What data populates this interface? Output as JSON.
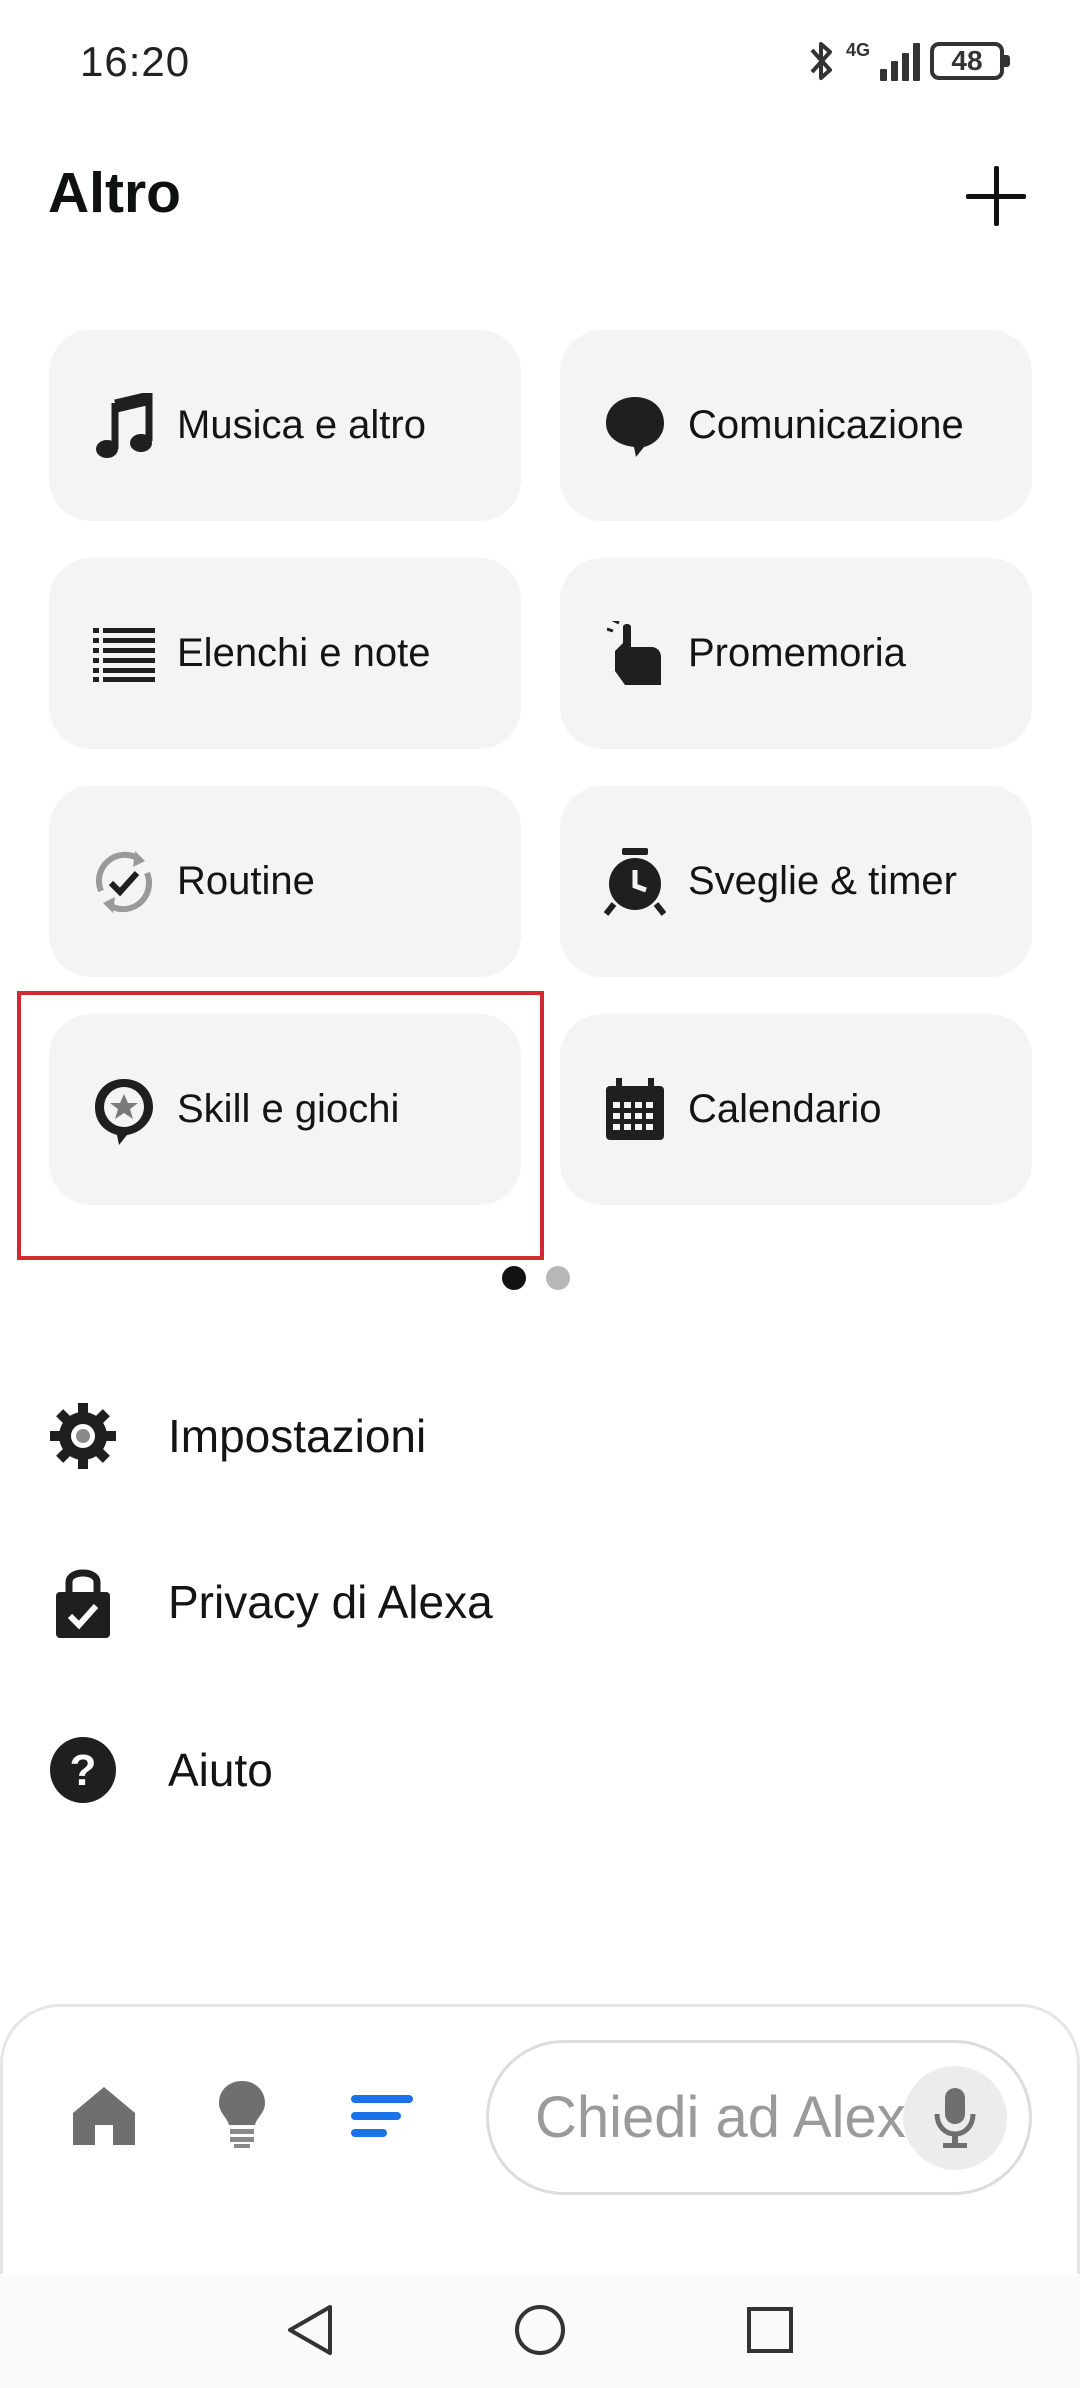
{
  "status_bar": {
    "time": "16:20",
    "network": "4G",
    "battery": "48"
  },
  "header": {
    "title": "Altro"
  },
  "tiles": [
    {
      "label": "Musica e altro",
      "icon": "music-note-icon"
    },
    {
      "label": "Comunicazione",
      "icon": "speech-bubble-icon"
    },
    {
      "label": "Elenchi e note",
      "icon": "list-icon"
    },
    {
      "label": "Promemoria",
      "icon": "reminder-hand-icon"
    },
    {
      "label": "Routine",
      "icon": "routine-cycle-icon"
    },
    {
      "label": "Sveglie & timer",
      "icon": "alarm-clock-icon"
    },
    {
      "label": "Skill e giochi",
      "icon": "skill-star-bubble-icon"
    },
    {
      "label": "Calendario",
      "icon": "calendar-icon"
    }
  ],
  "pager": {
    "pages": 2,
    "active": 1,
    "active_color": "#111111",
    "inactive_color": "#b8b8b8"
  },
  "menu": [
    {
      "label": "Impostazioni",
      "icon": "gear-icon"
    },
    {
      "label": "Privacy di Alexa",
      "icon": "privacy-lock-icon"
    },
    {
      "label": "Aiuto",
      "icon": "help-question-icon"
    }
  ],
  "bottom_nav": {
    "items": [
      "home-icon",
      "lightbulb-icon",
      "more-menu-icon"
    ],
    "active": "more-menu-icon",
    "active_color": "#1a73e8",
    "inactive_color": "#6f6f6f"
  },
  "ask": {
    "placeholder": "Chiedi ad Alexa"
  },
  "system_nav": [
    "back-triangle-icon",
    "home-circle-icon",
    "recents-square-icon"
  ],
  "highlight_color": "#d12b2f"
}
